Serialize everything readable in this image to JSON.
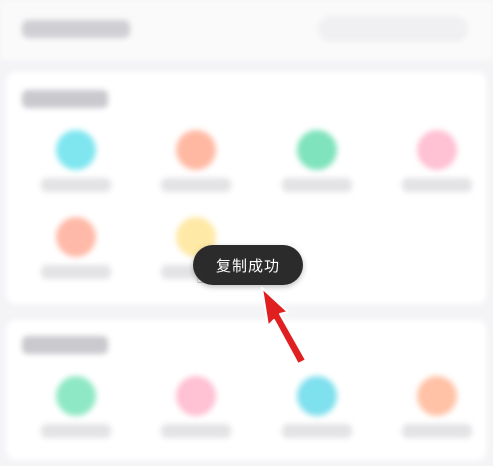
{
  "toast": {
    "text": "复制成功"
  },
  "colors": {
    "toast_bg": "#2b2b2b",
    "arrow": "#e02020",
    "page_bg": "#f4f4f7",
    "icon_colors": [
      "#7fe6f0",
      "#ffb9a3",
      "#7fe3bd",
      "#ffc1d4",
      "#ffb9a8",
      "#ffe9a6",
      "#8fe8c5",
      "#ffc1d4",
      "#7fe0ee",
      "#ffc2a6"
    ]
  },
  "icons": [
    "arrow-pointer-icon",
    "cursor-icon"
  ]
}
